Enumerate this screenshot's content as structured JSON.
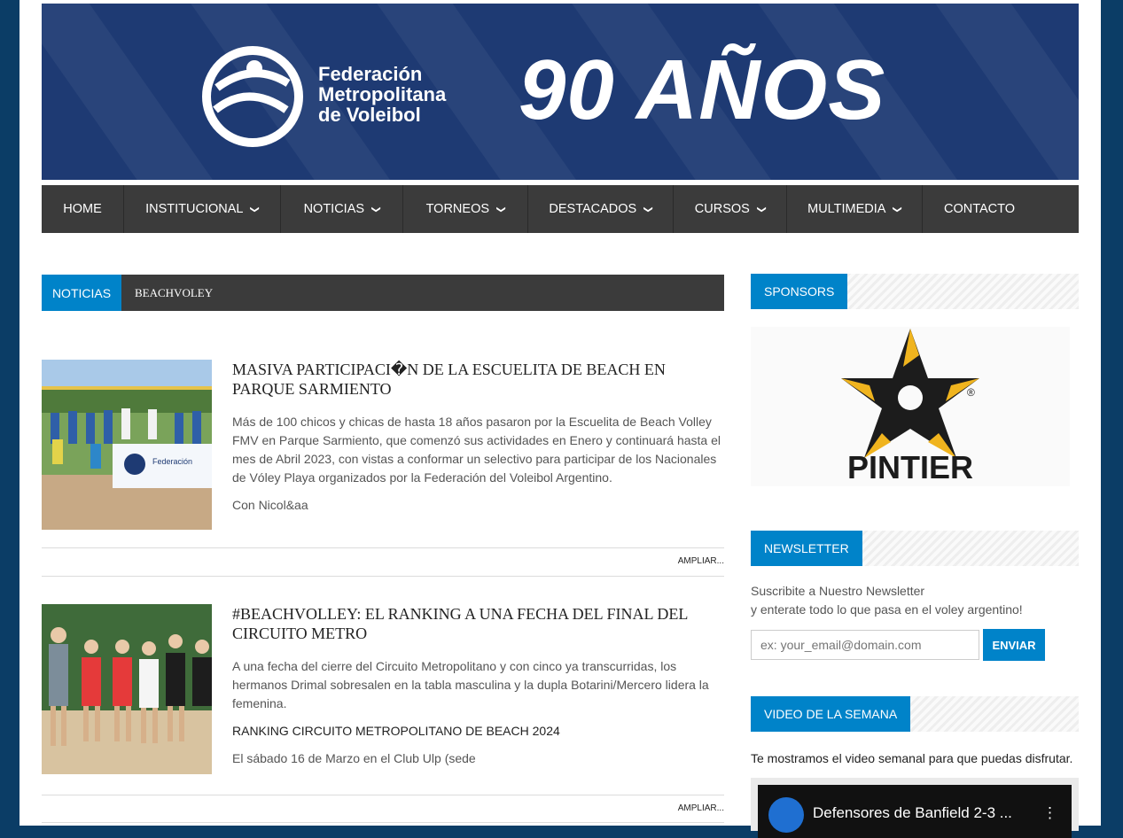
{
  "banner": {
    "org_line1": "Federación",
    "org_line2": "Metropolitana",
    "org_line3": "de Voleibol",
    "years": "90 AÑOS"
  },
  "nav": {
    "items": [
      {
        "label": "HOME",
        "has_dropdown": false
      },
      {
        "label": "INSTITUCIONAL",
        "has_dropdown": true
      },
      {
        "label": "NOTICIAS",
        "has_dropdown": true
      },
      {
        "label": "TORNEOS",
        "has_dropdown": true
      },
      {
        "label": "DESTACADOS",
        "has_dropdown": true
      },
      {
        "label": "CURSOS",
        "has_dropdown": true
      },
      {
        "label": "MULTIMEDIA",
        "has_dropdown": true
      },
      {
        "label": "CONTACTO",
        "has_dropdown": false
      }
    ]
  },
  "category": {
    "tab": "NOTICIAS",
    "sub": "BEACHVOLEY"
  },
  "articles": [
    {
      "title": "MASIVA PARTICIPACI�N DE LA ESCUELITA DE BEACH EN PARQUE SARMIENTO",
      "excerpt": "Más de 100 chicos y chicas de hasta 18 años pasaron por la Escuelita de Beach Volley FMV en Parque Sarmiento, que comenzó sus actividades en Enero y continuará hasta el mes de Abril 2023, con vistas a conformar un selectivo para participar de los Nacionales de Vóley Playa organizados por la Federación del Voleibol Argentino.",
      "extra": "Con Nicol&aa",
      "more": "AMPLIAR..."
    },
    {
      "title": "#BEACHVOLLEY: EL RANKING A UNA FECHA DEL FINAL DEL CIRCUITO METRO",
      "excerpt": "A una fecha del cierre del Circuito Metropolitano y con cinco ya transcurridas, los hermanos Drimal sobresalen en la tabla masculina y la dupla Botarini/Mercero lidera la femenina.",
      "subhead": "RANKING CIRCUITO METROPOLITANO DE BEACH 2024",
      "extra": "El sábado 16 de Marzo en el Club Ulp (sede",
      "more": "AMPLIAR..."
    }
  ],
  "sidebar": {
    "sponsors_title": "SPONSORS",
    "sponsor_name": "PINTIER",
    "newsletter_title": "NEWSLETTER",
    "newsletter_line1": "Suscribite a Nuestro Newsletter",
    "newsletter_line2": "y enterate todo lo que pasa en el voley argentino!",
    "email_placeholder": "ex: your_email@domain.com",
    "send_label": "ENVIAR",
    "video_title": "VIDEO DE LA SEMANA",
    "video_text": "Te mostramos el video semanal para que puedas disfrutar.",
    "video_caption": "Defensores de Banfield 2-3 ..."
  },
  "colors": {
    "accent": "#0083c9",
    "nav_bg": "#3b3b3b",
    "banner_bg": "#1e3a73",
    "outer_bg": "#0b3d66"
  }
}
